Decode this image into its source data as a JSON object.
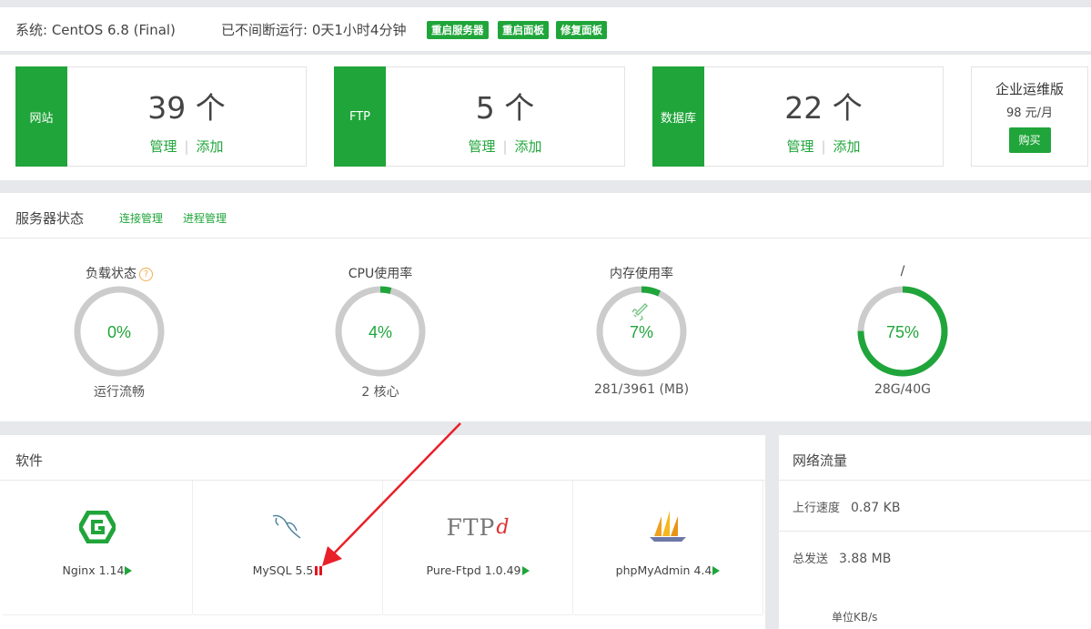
{
  "system": {
    "os_label": "系统: CentOS 6.8 (Final)",
    "uptime_label": "已不间断运行: 0天1小时4分钟",
    "buttons": [
      "重启服务器",
      "重启面板",
      "修复面板"
    ]
  },
  "stats": [
    {
      "tag": "网站",
      "count": "39 个",
      "manage": "管理",
      "add": "添加"
    },
    {
      "tag": "FTP",
      "count": "5 个",
      "manage": "管理",
      "add": "添加"
    },
    {
      "tag": "数据库",
      "count": "22 个",
      "manage": "管理",
      "add": "添加"
    }
  ],
  "enterprise": {
    "name": "企业运维版",
    "price": "98 元/月",
    "buy": "购买"
  },
  "server_status": {
    "title": "服务器状态",
    "links": [
      "连接管理",
      "进程管理"
    ],
    "gauges": [
      {
        "label": "负载状态",
        "value": "0%",
        "fraction": 0.0,
        "sub": "运行流畅",
        "help": "?"
      },
      {
        "label": "CPU使用率",
        "value": "4%",
        "fraction": 0.04,
        "sub": "2 核心"
      },
      {
        "label": "内存使用率",
        "value": "7%",
        "fraction": 0.07,
        "sub": "281/3961 (MB)"
      },
      {
        "label": "/",
        "value": "75%",
        "fraction": 0.75,
        "sub": "28G/40G"
      }
    ],
    "colors": {
      "accent": "#20a53a",
      "track": "#cccccc"
    }
  },
  "software": {
    "title": "软件",
    "items": [
      {
        "name": "Nginx 1.14",
        "status": "play",
        "icon": "nginx-icon"
      },
      {
        "name": "MySQL 5.5",
        "status": "pause",
        "icon": "mysql-icon"
      },
      {
        "name": "Pure-Ftpd 1.0.49",
        "status": "play",
        "icon": "ftpd-icon",
        "logo_text": "FTP",
        "logo_suffix": "d"
      },
      {
        "name": "phpMyAdmin 4.4",
        "status": "play",
        "icon": "phpmyadmin-icon"
      }
    ]
  },
  "network": {
    "title": "网络流量",
    "upload_label": "上行速度",
    "upload_value": "0.87 KB",
    "total_label": "总发送",
    "total_value": "3.88 MB",
    "unit": "单位KB/s"
  }
}
